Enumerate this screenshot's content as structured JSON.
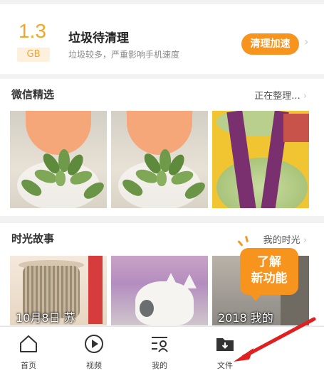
{
  "junk": {
    "size_value": "1.3",
    "size_unit": "GB",
    "title": "垃圾待清理",
    "subtitle": "垃圾较多，严重影响手机速度",
    "button": "清理加速"
  },
  "wechat_section": {
    "title": "微信精选",
    "status": "正在整理..."
  },
  "time_section": {
    "title": "时光故事",
    "link": "我的时光",
    "captions": [
      "10月8日 苏",
      "",
      "2018 我的"
    ]
  },
  "feature_bubble": {
    "line1": "了解",
    "line2": "新功能"
  },
  "bottom_nav": [
    {
      "label": "首页",
      "icon": "home-icon"
    },
    {
      "label": "视频",
      "icon": "play-icon"
    },
    {
      "label": "我的",
      "icon": "profile-list-icon"
    },
    {
      "label": "文件",
      "icon": "folder-download-icon"
    }
  ],
  "colors": {
    "accent": "#f7941d",
    "size_text": "#f5a623",
    "arrow": "#e02020"
  }
}
